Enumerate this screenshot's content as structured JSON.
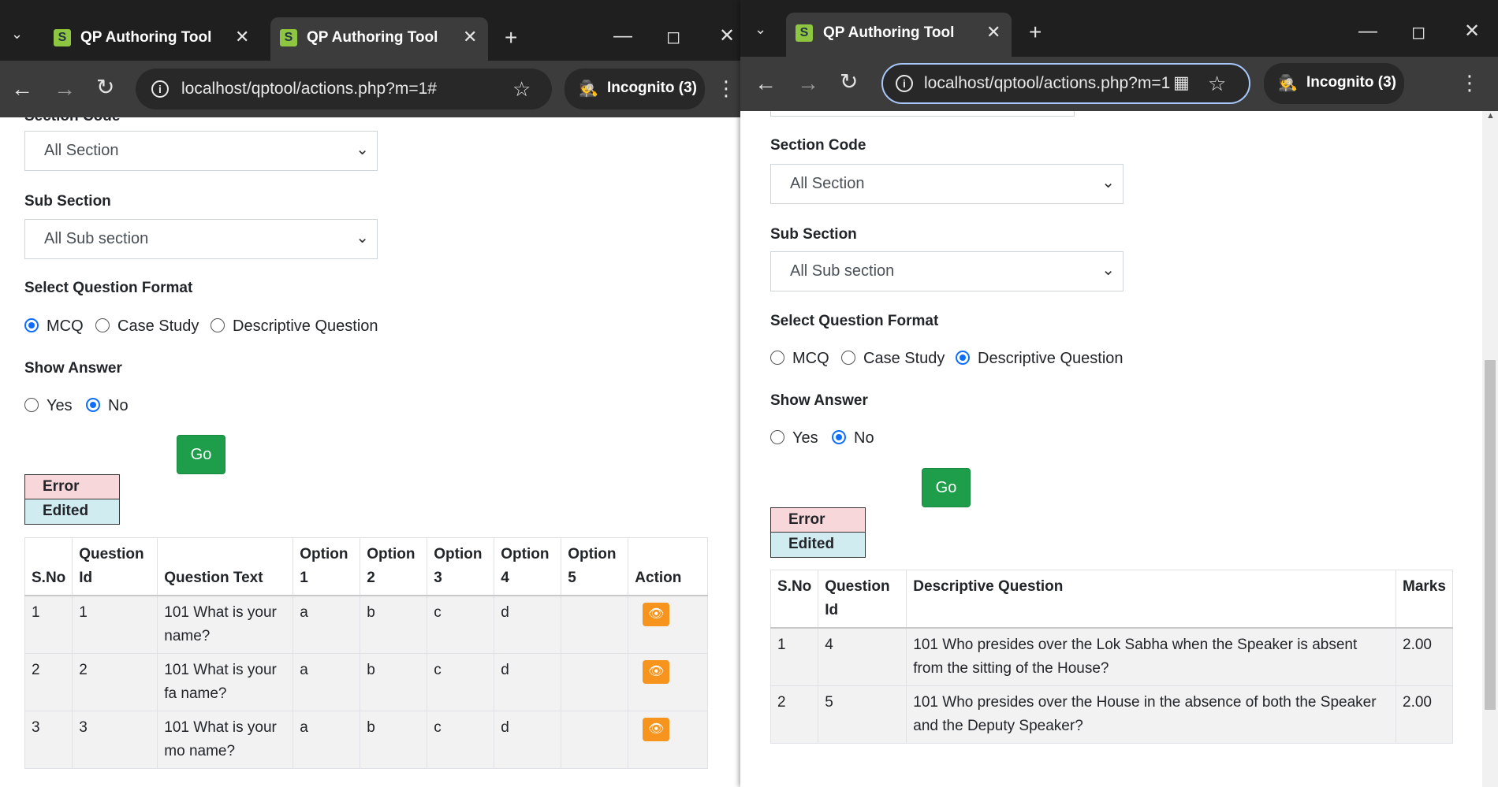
{
  "left_window": {
    "tabs": [
      {
        "title": "QP Authoring Tool",
        "active": false
      },
      {
        "title": "QP Authoring Tool",
        "active": true
      }
    ],
    "url": "localhost/qptool/actions.php?m=1#",
    "incognito": "Incognito (3)",
    "page": {
      "section_code_label": "Section Code",
      "section_code_value": "All Section",
      "sub_section_label": "Sub Section",
      "sub_section_value": "All Sub section",
      "question_format_label": "Select Question Format",
      "formats": [
        "MCQ",
        "Case Study",
        "Descriptive Question"
      ],
      "selected_format": "MCQ",
      "show_answer_label": "Show Answer",
      "answer_options": [
        "Yes",
        "No"
      ],
      "selected_answer": "No",
      "go_label": "Go",
      "legend": {
        "error": "Error",
        "edited": "Edited"
      },
      "table": {
        "headers": [
          "S.No",
          "Question Id",
          "Question Text",
          "Option 1",
          "Option 2",
          "Option 3",
          "Option 4",
          "Option 5",
          "Action"
        ],
        "rows": [
          {
            "sno": "1",
            "qid": "1",
            "text": "101 What is your name?",
            "o1": "a",
            "o2": "b",
            "o3": "c",
            "o4": "d",
            "o5": ""
          },
          {
            "sno": "2",
            "qid": "2",
            "text": "101 What is your fa name?",
            "o1": "a",
            "o2": "b",
            "o3": "c",
            "o4": "d",
            "o5": ""
          },
          {
            "sno": "3",
            "qid": "3",
            "text": "101 What is your mo name?",
            "o1": "a",
            "o2": "b",
            "o3": "c",
            "o4": "d",
            "o5": ""
          }
        ]
      }
    }
  },
  "right_window": {
    "tabs": [
      {
        "title": "QP Authoring Tool",
        "active": true
      }
    ],
    "url": "localhost/qptool/actions.php?m=1",
    "incognito": "Incognito (3)",
    "page": {
      "section_code_label": "Section Code",
      "section_code_value": "All Section",
      "sub_section_label": "Sub Section",
      "sub_section_value": "All Sub section",
      "question_format_label": "Select Question Format",
      "formats": [
        "MCQ",
        "Case Study",
        "Descriptive Question"
      ],
      "selected_format": "Descriptive Question",
      "show_answer_label": "Show Answer",
      "answer_options": [
        "Yes",
        "No"
      ],
      "selected_answer": "No",
      "go_label": "Go",
      "legend": {
        "error": "Error",
        "edited": "Edited"
      },
      "table": {
        "headers": [
          "S.No",
          "Question Id",
          "Descriptive Question",
          "Marks"
        ],
        "rows": [
          {
            "sno": "1",
            "qid": "4",
            "text": "101 Who presides over the Lok Sabha when the Speaker is absent from the sitting of the House?",
            "marks": "2.00"
          },
          {
            "sno": "2",
            "qid": "5",
            "text": "101 Who presides over the House in the absence of both the Speaker and the Deputy Speaker?",
            "marks": "2.00"
          }
        ]
      }
    }
  },
  "colors": {
    "tabstrip": "#1f1f1f",
    "toolbar": "#3c3c3c",
    "go_button": "#1e9e4a",
    "radio_accent": "#0d6efd",
    "error_bg": "#f8d7da",
    "edited_bg": "#d1ecf1",
    "action_button": "#f7941d"
  },
  "icons": {
    "favicon": "shiksha-s-logo-icon",
    "back": "arrow-left-icon",
    "forward": "arrow-right-icon",
    "reload": "reload-icon",
    "info": "info-circle-icon",
    "bookmark": "star-icon",
    "qr": "qr-code-icon",
    "incognito": "incognito-icon",
    "menu": "kebab-menu-icon",
    "action": "eye-icon"
  }
}
